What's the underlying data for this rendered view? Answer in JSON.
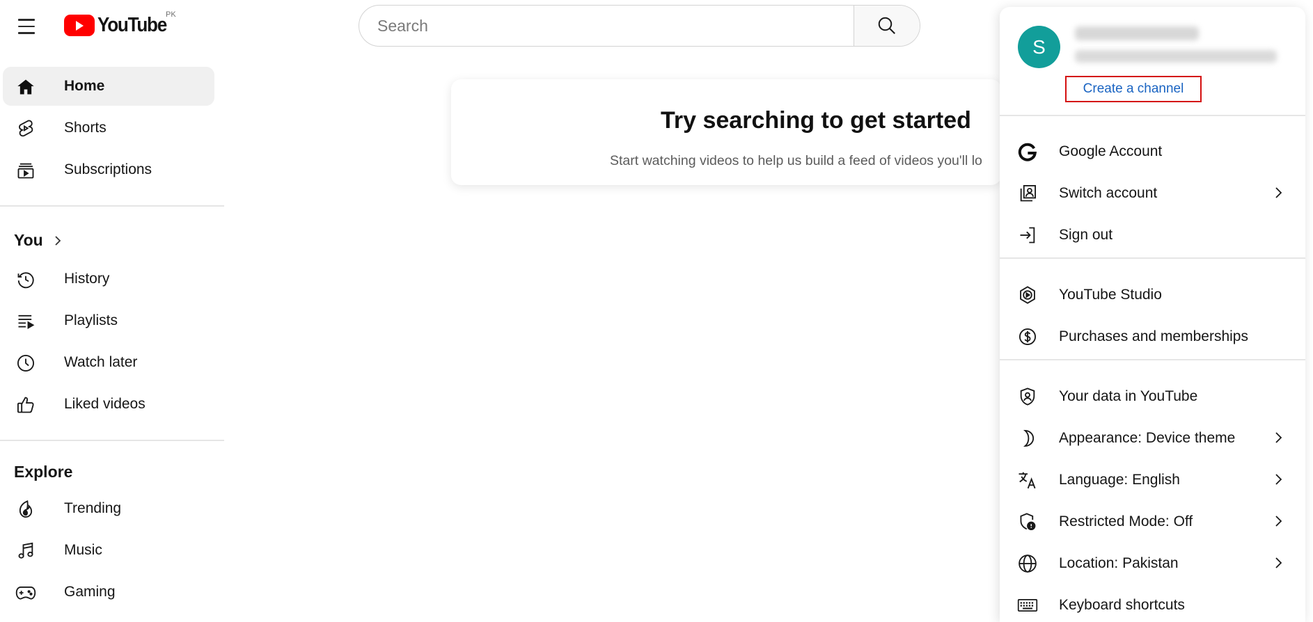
{
  "header": {
    "logo_text": "YouTube",
    "region": "PK",
    "search_placeholder": "Search"
  },
  "sidebar": {
    "primary": [
      {
        "label": "Home",
        "icon": "home-icon",
        "active": true
      },
      {
        "label": "Shorts",
        "icon": "shorts-icon"
      },
      {
        "label": "Subscriptions",
        "icon": "subscriptions-icon"
      }
    ],
    "you_title": "You",
    "you_items": [
      {
        "label": "History",
        "icon": "history-icon"
      },
      {
        "label": "Playlists",
        "icon": "playlists-icon"
      },
      {
        "label": "Watch later",
        "icon": "watch-later-icon"
      },
      {
        "label": "Liked videos",
        "icon": "liked-videos-icon"
      }
    ],
    "explore_title": "Explore",
    "explore_items": [
      {
        "label": "Trending",
        "icon": "trending-icon"
      },
      {
        "label": "Music",
        "icon": "music-icon"
      },
      {
        "label": "Gaming",
        "icon": "gaming-icon"
      }
    ]
  },
  "main": {
    "title": "Try searching to get started",
    "subtitle": "Start watching videos to help us build a feed of videos you'll lo"
  },
  "account_menu": {
    "avatar_letter": "S",
    "avatar_color": "#129e9a",
    "create_channel": "Create a channel",
    "highlight_color": "#d40f0f",
    "items": [
      {
        "label": "Google Account",
        "icon": "google-icon"
      },
      {
        "label": "Switch account",
        "icon": "switch-account-icon",
        "has_submenu": true
      },
      {
        "label": "Sign out",
        "icon": "sign-out-icon"
      },
      {
        "label": "YouTube Studio",
        "icon": "youtube-studio-icon"
      },
      {
        "label": "Purchases and memberships",
        "icon": "purchases-icon"
      },
      {
        "label": "Your data in YouTube",
        "icon": "your-data-icon"
      },
      {
        "label": "Appearance: Device theme",
        "icon": "appearance-icon",
        "has_submenu": true
      },
      {
        "label": "Language: English",
        "icon": "language-icon",
        "has_submenu": true
      },
      {
        "label": "Restricted Mode: Off",
        "icon": "restricted-mode-icon",
        "has_submenu": true
      },
      {
        "label": "Location: Pakistan",
        "icon": "location-icon",
        "has_submenu": true
      },
      {
        "label": "Keyboard shortcuts",
        "icon": "keyboard-icon"
      }
    ]
  }
}
